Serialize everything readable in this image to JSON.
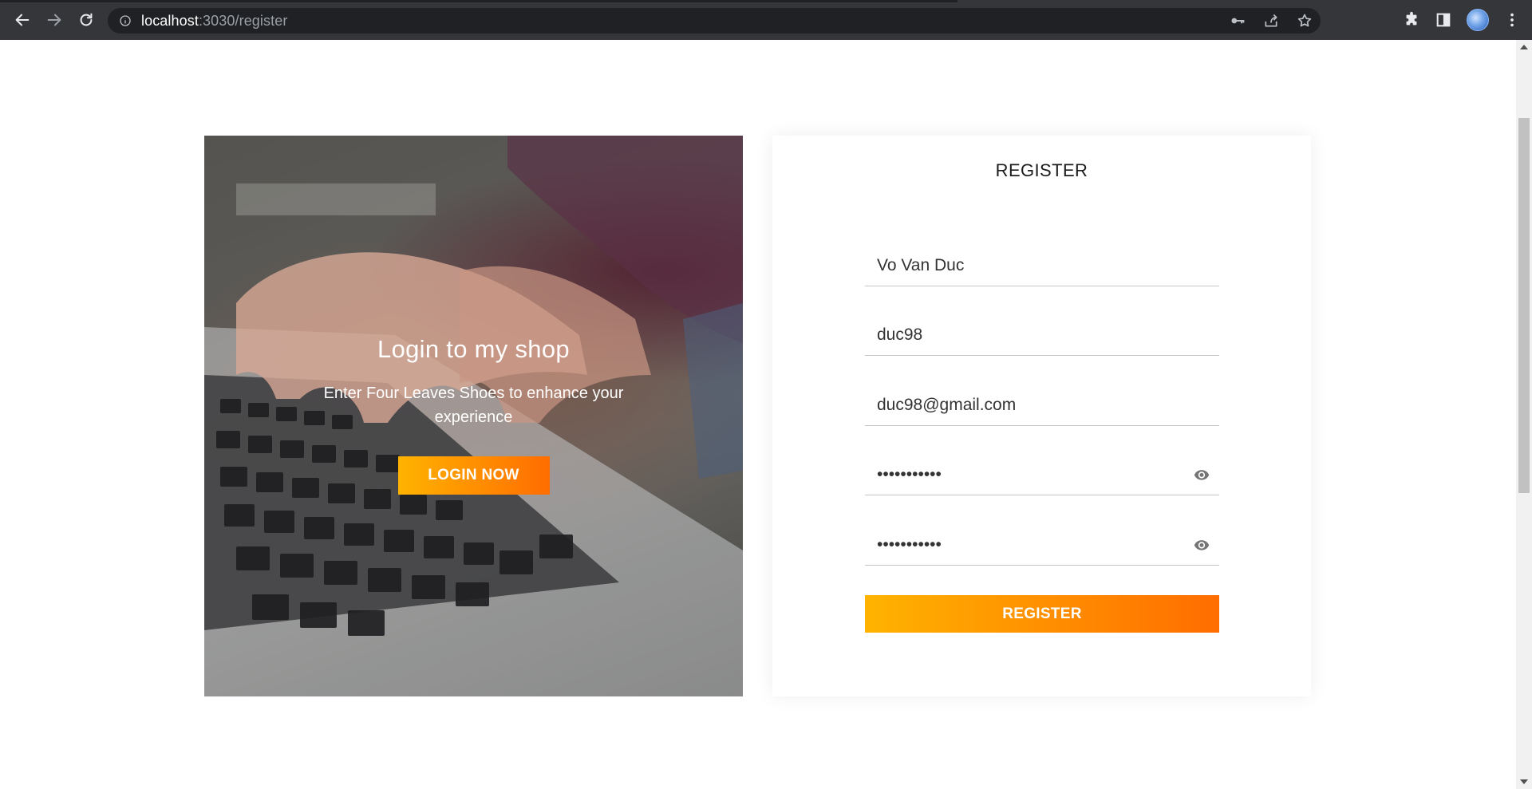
{
  "browser": {
    "url_host": "localhost",
    "url_path": ":3030/register"
  },
  "hero": {
    "title": "Login to my shop",
    "subtitle": "Enter Four Leaves Shoes to enhance your experience",
    "login_button_label": "LOGIN NOW"
  },
  "register": {
    "heading": "REGISTER",
    "full_name_value": "Vo Van Duc",
    "username_value": "duc98",
    "email_value": "duc98@gmail.com",
    "password_value": "abcdef12345",
    "confirm_password_value": "abcdef12345",
    "submit_label": "REGISTER"
  },
  "colors": {
    "accent_start": "#ffb300",
    "accent_end": "#ff6d00"
  }
}
